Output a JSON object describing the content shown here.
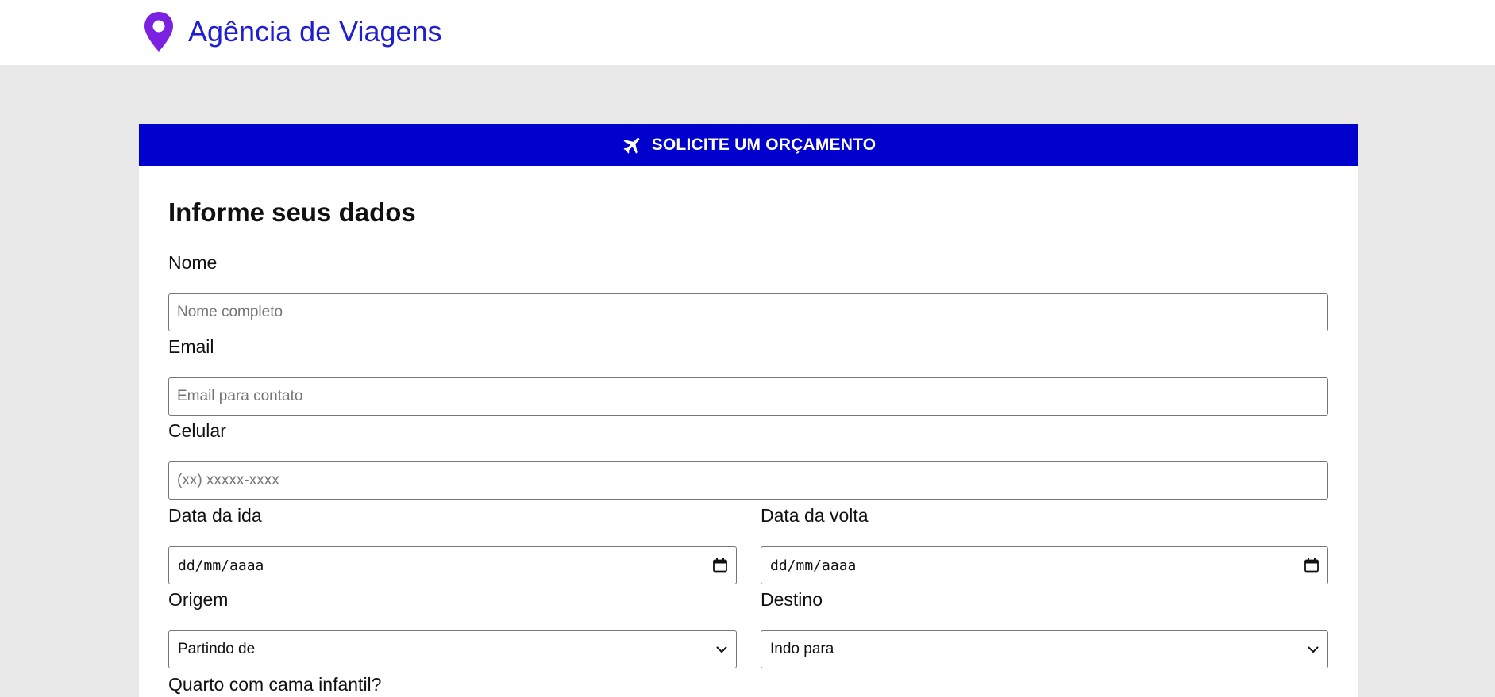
{
  "header": {
    "brand_icon": "map-pin-icon",
    "brand_name": "Agência de Viagens",
    "brand_color": "#1f1fcf",
    "pin_color": "#7a22e0"
  },
  "quote_card": {
    "header_icon": "airplane-icon",
    "header_title": "SOLICITE UM ORÇAMENTO",
    "header_color": "#0000cc"
  },
  "form": {
    "title": "Informe seus dados",
    "name": {
      "label": "Nome",
      "placeholder": "Nome completo",
      "value": ""
    },
    "email": {
      "label": "Email",
      "placeholder": "Email para contato",
      "value": ""
    },
    "phone": {
      "label": "Celular",
      "placeholder": "(xx) xxxxx-xxxx",
      "value": ""
    },
    "departure_date": {
      "label": "Data da ida",
      "value": "dd/mm/aaaa",
      "icon": "calendar-icon"
    },
    "return_date": {
      "label": "Data da volta",
      "value": "dd/mm/aaaa",
      "icon": "calendar-icon"
    },
    "origin": {
      "label": "Origem",
      "selected": "Partindo de",
      "icon": "chevron-down-icon"
    },
    "destination": {
      "label": "Destino",
      "selected": "Indo para",
      "icon": "chevron-down-icon"
    },
    "child_bed": {
      "label": "Quarto com cama infantil?"
    }
  }
}
